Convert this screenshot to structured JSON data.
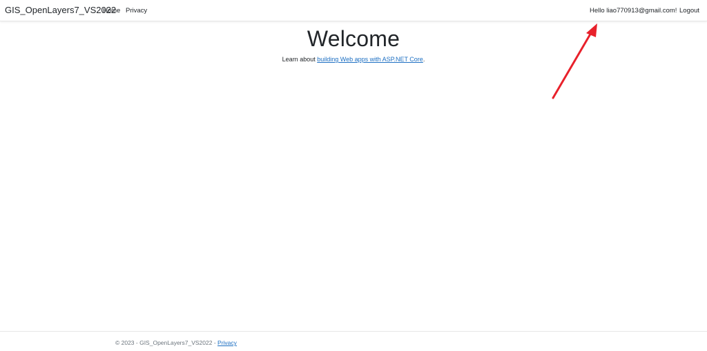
{
  "navbar": {
    "brand": "GIS_OpenLayers7_VS2022",
    "links": [
      {
        "label": "Home"
      },
      {
        "label": "Privacy"
      }
    ],
    "user": {
      "greeting": "Hello liao770913@gmail.com!",
      "logout": "Logout"
    }
  },
  "main": {
    "title": "Welcome",
    "lead_prefix": "Learn about ",
    "lead_link": "building Web apps with ASP.NET Core",
    "lead_suffix": "."
  },
  "footer": {
    "text": "© 2023 - GIS_OpenLayers7_VS2022 - ",
    "privacy_link": "Privacy"
  },
  "annotation": {
    "icon": "arrow-icon",
    "color": "#e8212b"
  },
  "colors": {
    "link": "#1b6ec2",
    "text": "#212529",
    "muted": "#6c757d"
  }
}
